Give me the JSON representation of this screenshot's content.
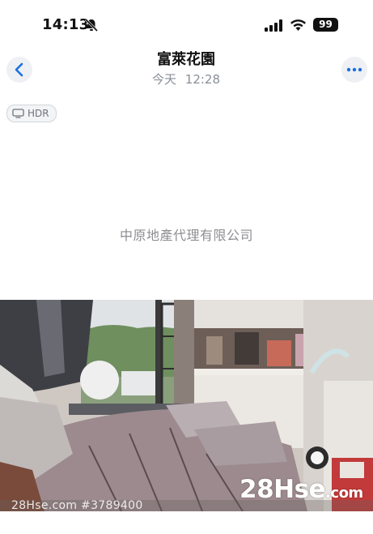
{
  "status_bar": {
    "time": "14:13",
    "battery_level": "99",
    "icons": [
      "silent-bell-icon",
      "signal-icon",
      "wifi-icon",
      "battery-icon"
    ]
  },
  "header": {
    "title": "富萊花園",
    "date_label": "今天",
    "time_label": "12:28",
    "back_icon": "chevron-left-icon",
    "more_icon": "ellipsis-icon"
  },
  "badge": {
    "label": "HDR",
    "icon": "display-icon"
  },
  "content": {
    "company_name": "中原地產代理有限公司"
  },
  "photo": {
    "watermark_logo": "28Hse",
    "watermark_suffix": ".com",
    "watermark_id": "28Hse.com #3789400"
  },
  "colors": {
    "accent": "#1a6fe0",
    "secondary_text": "#8a8f98",
    "button_bg": "#eef0f4"
  }
}
